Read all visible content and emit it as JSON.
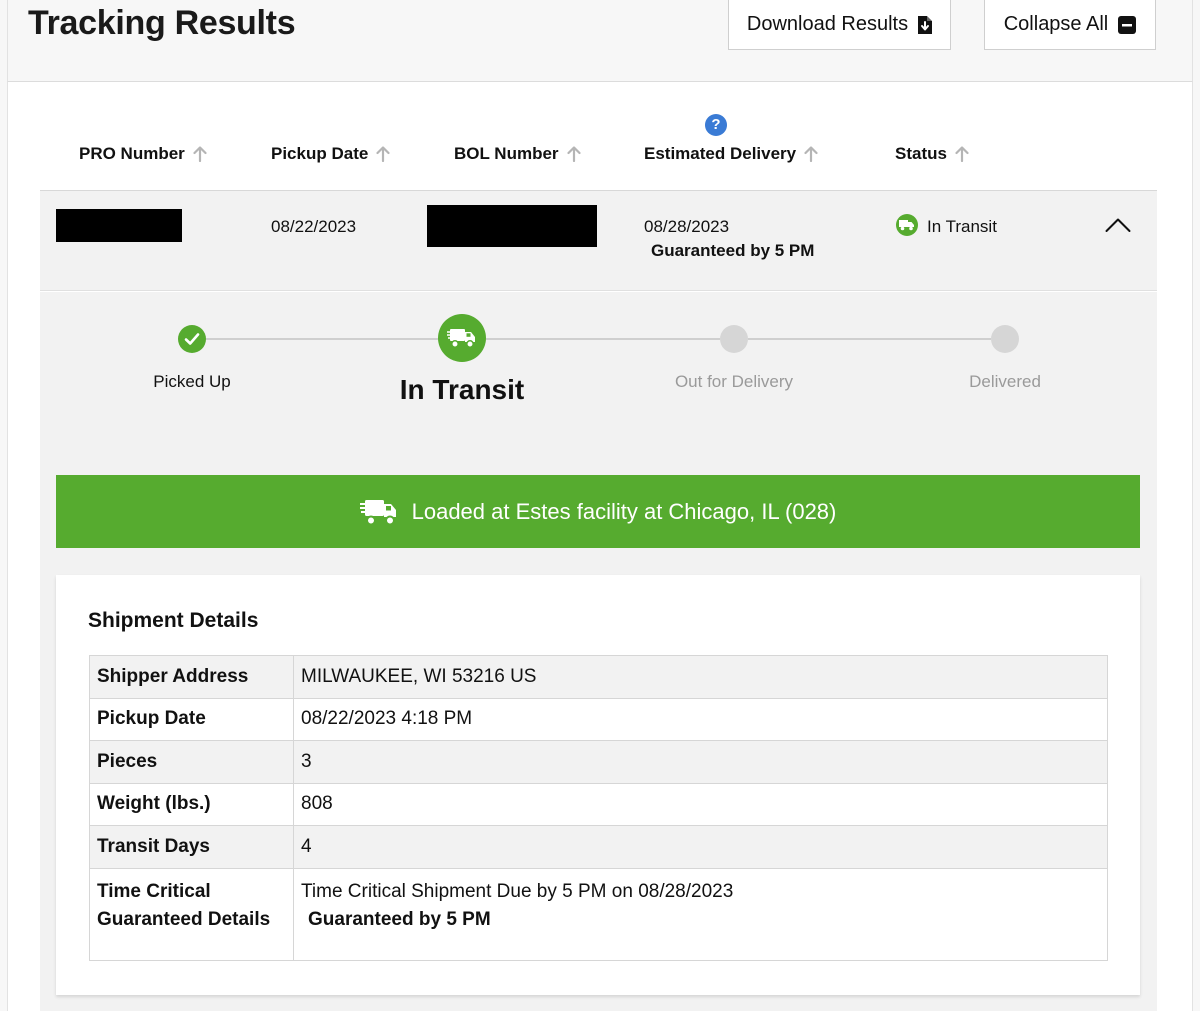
{
  "header": {
    "title": "Tracking Results",
    "download_label": "Download Results",
    "collapse_label": "Collapse All"
  },
  "columns": {
    "pro": "PRO Number",
    "pickup": "Pickup Date",
    "bol": "BOL Number",
    "estimated": "Estimated Delivery",
    "status": "Status",
    "help": "?"
  },
  "row": {
    "pickup_date": "08/22/2023",
    "estimated_delivery": "08/28/2023",
    "guaranteed": "Guaranteed by 5 PM",
    "status": "In Transit"
  },
  "progress": {
    "steps": [
      "Picked Up",
      "In Transit",
      "Out for Delivery",
      "Delivered"
    ],
    "current_step": 1
  },
  "event": {
    "message": "Loaded at Estes facility at Chicago, IL (028)"
  },
  "details": {
    "title": "Shipment Details",
    "rows": [
      {
        "label": "Shipper Address",
        "value": "MILWAUKEE, WI 53216 US"
      },
      {
        "label": "Pickup Date",
        "value": "08/22/2023 4:18 PM"
      },
      {
        "label": "Pieces",
        "value": "3"
      },
      {
        "label": "Weight (lbs.)",
        "value": "808"
      },
      {
        "label": "Transit Days",
        "value": "4"
      },
      {
        "label": "Time Critical Guaranteed Details",
        "value": "Time Critical Shipment Due by 5 PM on 08/28/2023",
        "extra": "Guaranteed by 5 PM"
      }
    ]
  },
  "colors": {
    "accent_green": "#56ab2f",
    "pending_gray": "#d6d6d6",
    "help_blue": "#3a7bd5"
  },
  "icons": {
    "download": "file-download-icon",
    "collapse": "minus-square-icon",
    "sort": "arrow-up-icon",
    "truck": "truck-icon",
    "check": "check-icon",
    "chevron": "chevron-up-icon"
  }
}
